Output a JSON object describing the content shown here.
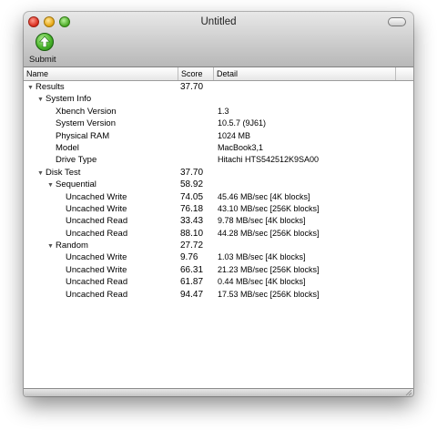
{
  "window": {
    "title": "Untitled"
  },
  "toolbar": {
    "submit_label": "Submit"
  },
  "columns": {
    "name": "Name",
    "score": "Score",
    "detail": "Detail"
  },
  "rows": [
    {
      "name": "Results",
      "score": "37.70",
      "detail": "",
      "level": 0,
      "expandable": true
    },
    {
      "name": "System Info",
      "score": "",
      "detail": "",
      "level": 1,
      "expandable": true
    },
    {
      "name": "Xbench Version",
      "score": "",
      "detail": "1.3",
      "level": 2,
      "expandable": false
    },
    {
      "name": "System Version",
      "score": "",
      "detail": "10.5.7 (9J61)",
      "level": 2,
      "expandable": false
    },
    {
      "name": "Physical RAM",
      "score": "",
      "detail": "1024 MB",
      "level": 2,
      "expandable": false
    },
    {
      "name": "Model",
      "score": "",
      "detail": "MacBook3,1",
      "level": 2,
      "expandable": false
    },
    {
      "name": "Drive Type",
      "score": "",
      "detail": "Hitachi HTS542512K9SA00",
      "level": 2,
      "expandable": false
    },
    {
      "name": "Disk Test",
      "score": "37.70",
      "detail": "",
      "level": 1,
      "expandable": true
    },
    {
      "name": "Sequential",
      "score": "58.92",
      "detail": "",
      "level": 2,
      "expandable": true
    },
    {
      "name": "Uncached Write",
      "score": "74.05",
      "detail": "45.46 MB/sec [4K blocks]",
      "level": 3,
      "expandable": false
    },
    {
      "name": "Uncached Write",
      "score": "76.18",
      "detail": "43.10 MB/sec [256K blocks]",
      "level": 3,
      "expandable": false
    },
    {
      "name": "Uncached Read",
      "score": "33.43",
      "detail": "9.78 MB/sec [4K blocks]",
      "level": 3,
      "expandable": false
    },
    {
      "name": "Uncached Read",
      "score": "88.10",
      "detail": "44.28 MB/sec [256K blocks]",
      "level": 3,
      "expandable": false
    },
    {
      "name": "Random",
      "score": "27.72",
      "detail": "",
      "level": 2,
      "expandable": true
    },
    {
      "name": "Uncached Write",
      "score": "9.76",
      "detail": "1.03 MB/sec [4K blocks]",
      "level": 3,
      "expandable": false
    },
    {
      "name": "Uncached Write",
      "score": "66.31",
      "detail": "21.23 MB/sec [256K blocks]",
      "level": 3,
      "expandable": false
    },
    {
      "name": "Uncached Read",
      "score": "61.87",
      "detail": "0.44 MB/sec [4K blocks]",
      "level": 3,
      "expandable": false
    },
    {
      "name": "Uncached Read",
      "score": "94.47",
      "detail": "17.53 MB/sec [256K blocks]",
      "level": 3,
      "expandable": false
    }
  ],
  "icons": {
    "close": "close-icon",
    "minimize": "minimize-icon",
    "zoom": "zoom-icon",
    "submit": "upload-arrow-icon",
    "disclosure": "disclosure-triangle-icon",
    "resize": "resize-grip-icon"
  },
  "colors": {
    "submit_green": "#4bb52c",
    "close_red": "#d8291a",
    "min_yellow": "#e5a40e",
    "zoom_green": "#4aa824"
  }
}
